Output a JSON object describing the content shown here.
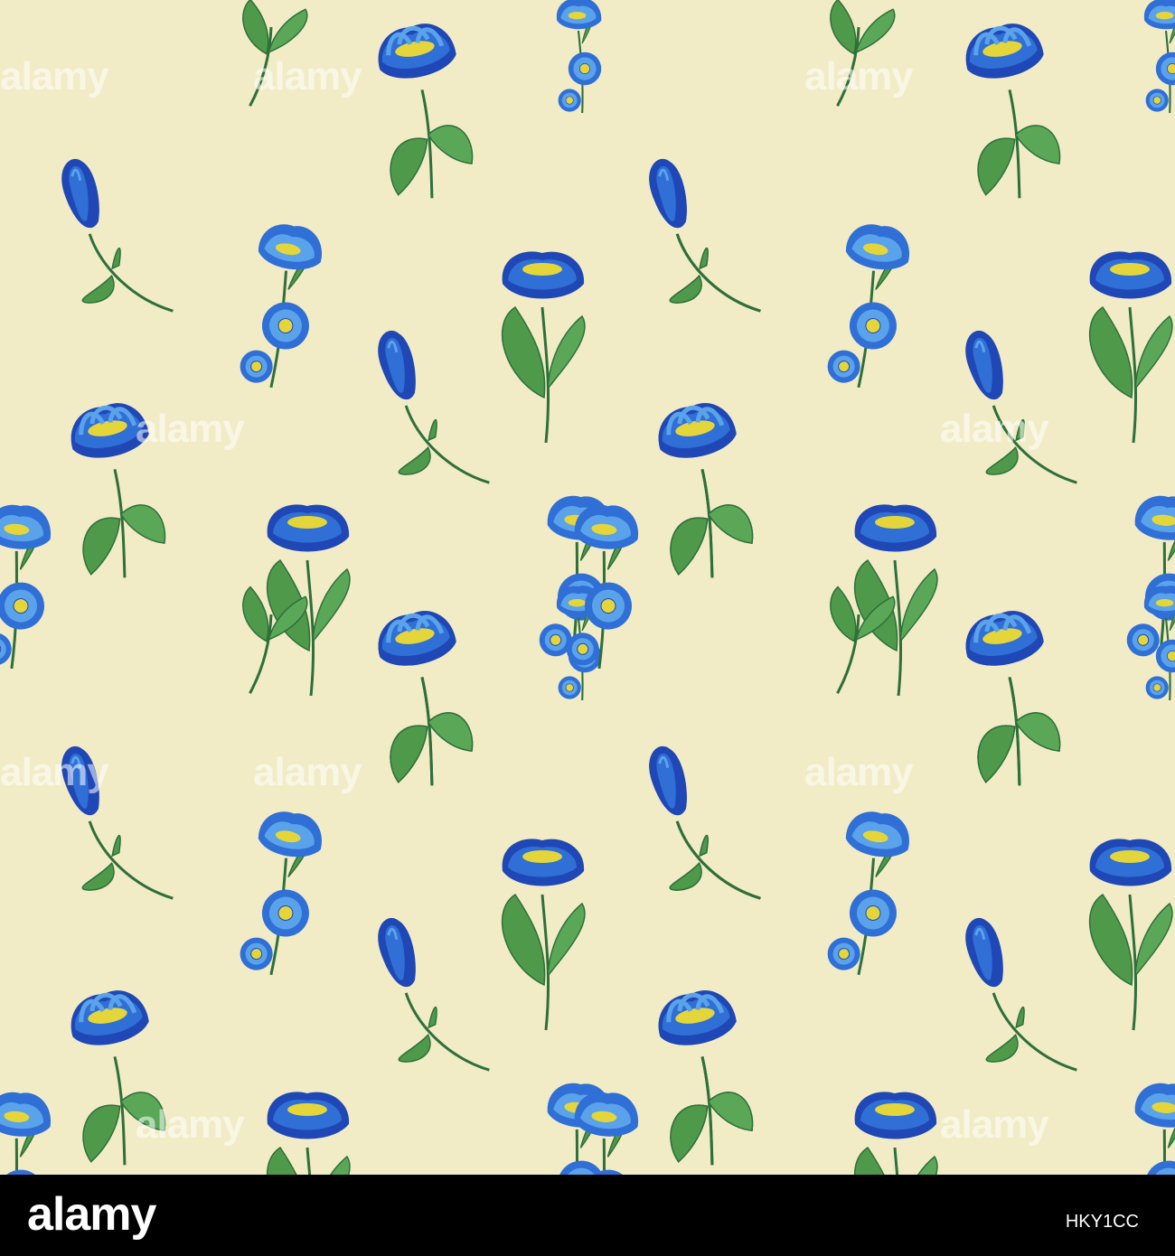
{
  "artwork": {
    "palette": {
      "paper": "#f1ecc6",
      "petal_dark": "#1f47b5",
      "petal_mid": "#2f6fd6",
      "petal_light": "#5aa3ea",
      "leaf": "#4f9a4a",
      "leaf_dark": "#2f6f3a",
      "center": "#e4d63a"
    }
  },
  "watermark": {
    "text": "alamy"
  },
  "footer": {
    "brand": "alamy",
    "image_id": "HKY1CC",
    "background": "#000000"
  }
}
